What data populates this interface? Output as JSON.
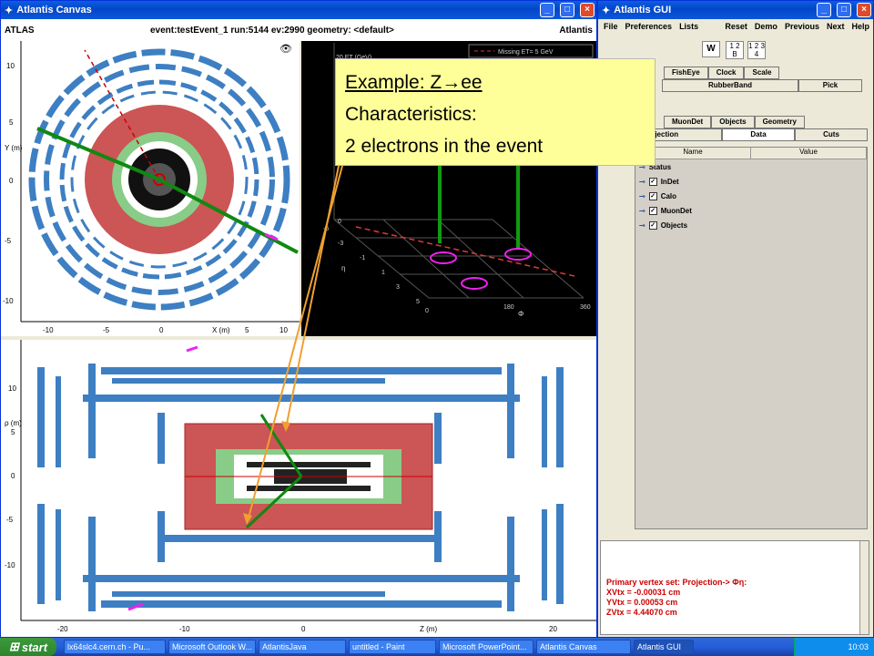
{
  "canvas": {
    "title": "Atlantis Canvas",
    "head_left": "ATLAS",
    "head_mid": "event:testEvent_1 run:5144 ev:2990  geometry: <default>",
    "head_right": "Atlantis",
    "yx_view": {
      "ylabel": "Y (m)",
      "xlabel": "X (m)",
      "yticks": [
        "10",
        "5",
        "0",
        "-5",
        "-10"
      ],
      "xticks": [
        "-10",
        "-5",
        "0",
        "5",
        "10"
      ]
    },
    "lego_view": {
      "legend": [
        "Missing ET= 5 GeV"
      ],
      "et_label": "20 ET (GeV)",
      "eta_label": "η",
      "phi_label": "Φ",
      "eta_ticks": [
        "-5",
        "-3",
        "-1",
        "1",
        "3",
        "5"
      ],
      "phi_ticks": [
        "0",
        "180",
        "360"
      ],
      "z_ticks": [
        "0",
        "5"
      ]
    },
    "rz_view": {
      "ylabel": "ρ (m)",
      "xlabel": "Z (m)",
      "yticks": [
        "10",
        "5",
        "0",
        "-5",
        "-10"
      ],
      "xticks": [
        "-20",
        "-10",
        "0",
        "10",
        "20"
      ]
    }
  },
  "gui": {
    "title": "Atlantis GUI",
    "menu": [
      "File",
      "Preferences",
      "Lists"
    ],
    "menu_right": [
      "Reset",
      "Demo",
      "Previous",
      "Next",
      "Help"
    ],
    "w_label": "W",
    "layout1": "1 2 B",
    "layout2": "1 2 3 4",
    "tabs1": [
      "FishEye",
      "Clock",
      "Scale"
    ],
    "tabs2": [
      "RubberBand",
      "Pick"
    ],
    "tabs3": [
      "MuonDet",
      "Objects",
      "Geometry"
    ],
    "tabs4": [
      "Projection",
      "Data",
      "Cuts"
    ],
    "tree_cols": [
      "Name",
      "Value"
    ],
    "tree_items": [
      "Status",
      "InDet",
      "Calo",
      "MuonDet",
      "Objects"
    ],
    "console_lines": [
      "Primary vertex set: Projection-> Φη:",
      "  XVtx = -0.00031 cm",
      "  YVtx = 0.00053 cm",
      "  ZVtx = 4.44070 cm"
    ]
  },
  "callout": {
    "line1": "Example: Z→ee",
    "line2": "Characteristics:",
    "line3": "2 electrons in the event"
  },
  "taskbar": {
    "start": "start",
    "tasks": [
      "lx64slc4.cern.ch - Pu...",
      "Microsoft Outlook W...",
      "AtlantisJava",
      "untitled - Paint",
      "Microsoft PowerPoint...",
      "Atlantis Canvas",
      "Atlantis GUI"
    ],
    "clock": "10:03"
  },
  "colors": {
    "calo_red": "#cc5555",
    "calo_green": "#66bb66",
    "muon_blue": "#3d7fc2",
    "track_green": "#118811",
    "electron_magenta": "#ee22ee"
  }
}
